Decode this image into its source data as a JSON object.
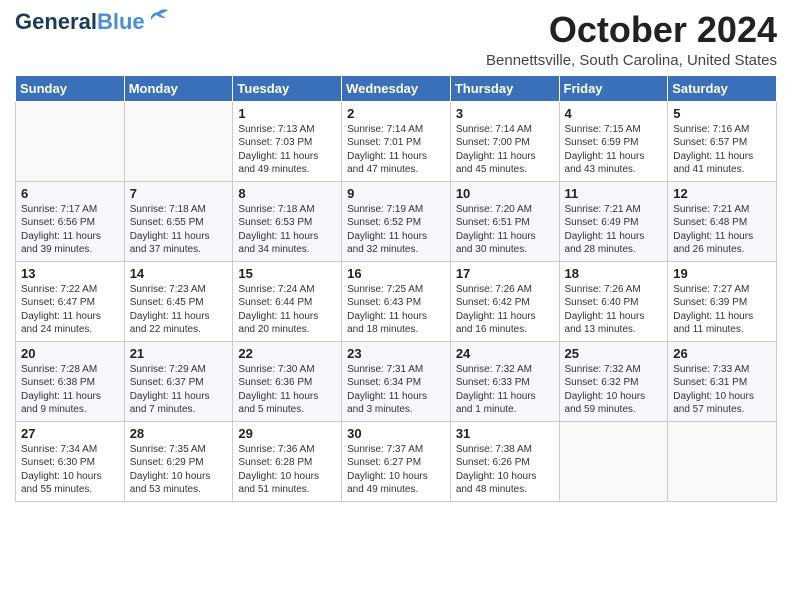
{
  "logo": {
    "line1": "General",
    "line2": "Blue"
  },
  "title": "October 2024",
  "subtitle": "Bennettsville, South Carolina, United States",
  "days_of_week": [
    "Sunday",
    "Monday",
    "Tuesday",
    "Wednesday",
    "Thursday",
    "Friday",
    "Saturday"
  ],
  "weeks": [
    [
      {
        "day": "",
        "info": ""
      },
      {
        "day": "",
        "info": ""
      },
      {
        "day": "1",
        "info": "Sunrise: 7:13 AM\nSunset: 7:03 PM\nDaylight: 11 hours and 49 minutes."
      },
      {
        "day": "2",
        "info": "Sunrise: 7:14 AM\nSunset: 7:01 PM\nDaylight: 11 hours and 47 minutes."
      },
      {
        "day": "3",
        "info": "Sunrise: 7:14 AM\nSunset: 7:00 PM\nDaylight: 11 hours and 45 minutes."
      },
      {
        "day": "4",
        "info": "Sunrise: 7:15 AM\nSunset: 6:59 PM\nDaylight: 11 hours and 43 minutes."
      },
      {
        "day": "5",
        "info": "Sunrise: 7:16 AM\nSunset: 6:57 PM\nDaylight: 11 hours and 41 minutes."
      }
    ],
    [
      {
        "day": "6",
        "info": "Sunrise: 7:17 AM\nSunset: 6:56 PM\nDaylight: 11 hours and 39 minutes."
      },
      {
        "day": "7",
        "info": "Sunrise: 7:18 AM\nSunset: 6:55 PM\nDaylight: 11 hours and 37 minutes."
      },
      {
        "day": "8",
        "info": "Sunrise: 7:18 AM\nSunset: 6:53 PM\nDaylight: 11 hours and 34 minutes."
      },
      {
        "day": "9",
        "info": "Sunrise: 7:19 AM\nSunset: 6:52 PM\nDaylight: 11 hours and 32 minutes."
      },
      {
        "day": "10",
        "info": "Sunrise: 7:20 AM\nSunset: 6:51 PM\nDaylight: 11 hours and 30 minutes."
      },
      {
        "day": "11",
        "info": "Sunrise: 7:21 AM\nSunset: 6:49 PM\nDaylight: 11 hours and 28 minutes."
      },
      {
        "day": "12",
        "info": "Sunrise: 7:21 AM\nSunset: 6:48 PM\nDaylight: 11 hours and 26 minutes."
      }
    ],
    [
      {
        "day": "13",
        "info": "Sunrise: 7:22 AM\nSunset: 6:47 PM\nDaylight: 11 hours and 24 minutes."
      },
      {
        "day": "14",
        "info": "Sunrise: 7:23 AM\nSunset: 6:45 PM\nDaylight: 11 hours and 22 minutes."
      },
      {
        "day": "15",
        "info": "Sunrise: 7:24 AM\nSunset: 6:44 PM\nDaylight: 11 hours and 20 minutes."
      },
      {
        "day": "16",
        "info": "Sunrise: 7:25 AM\nSunset: 6:43 PM\nDaylight: 11 hours and 18 minutes."
      },
      {
        "day": "17",
        "info": "Sunrise: 7:26 AM\nSunset: 6:42 PM\nDaylight: 11 hours and 16 minutes."
      },
      {
        "day": "18",
        "info": "Sunrise: 7:26 AM\nSunset: 6:40 PM\nDaylight: 11 hours and 13 minutes."
      },
      {
        "day": "19",
        "info": "Sunrise: 7:27 AM\nSunset: 6:39 PM\nDaylight: 11 hours and 11 minutes."
      }
    ],
    [
      {
        "day": "20",
        "info": "Sunrise: 7:28 AM\nSunset: 6:38 PM\nDaylight: 11 hours and 9 minutes."
      },
      {
        "day": "21",
        "info": "Sunrise: 7:29 AM\nSunset: 6:37 PM\nDaylight: 11 hours and 7 minutes."
      },
      {
        "day": "22",
        "info": "Sunrise: 7:30 AM\nSunset: 6:36 PM\nDaylight: 11 hours and 5 minutes."
      },
      {
        "day": "23",
        "info": "Sunrise: 7:31 AM\nSunset: 6:34 PM\nDaylight: 11 hours and 3 minutes."
      },
      {
        "day": "24",
        "info": "Sunrise: 7:32 AM\nSunset: 6:33 PM\nDaylight: 11 hours and 1 minute."
      },
      {
        "day": "25",
        "info": "Sunrise: 7:32 AM\nSunset: 6:32 PM\nDaylight: 10 hours and 59 minutes."
      },
      {
        "day": "26",
        "info": "Sunrise: 7:33 AM\nSunset: 6:31 PM\nDaylight: 10 hours and 57 minutes."
      }
    ],
    [
      {
        "day": "27",
        "info": "Sunrise: 7:34 AM\nSunset: 6:30 PM\nDaylight: 10 hours and 55 minutes."
      },
      {
        "day": "28",
        "info": "Sunrise: 7:35 AM\nSunset: 6:29 PM\nDaylight: 10 hours and 53 minutes."
      },
      {
        "day": "29",
        "info": "Sunrise: 7:36 AM\nSunset: 6:28 PM\nDaylight: 10 hours and 51 minutes."
      },
      {
        "day": "30",
        "info": "Sunrise: 7:37 AM\nSunset: 6:27 PM\nDaylight: 10 hours and 49 minutes."
      },
      {
        "day": "31",
        "info": "Sunrise: 7:38 AM\nSunset: 6:26 PM\nDaylight: 10 hours and 48 minutes."
      },
      {
        "day": "",
        "info": ""
      },
      {
        "day": "",
        "info": ""
      }
    ]
  ]
}
